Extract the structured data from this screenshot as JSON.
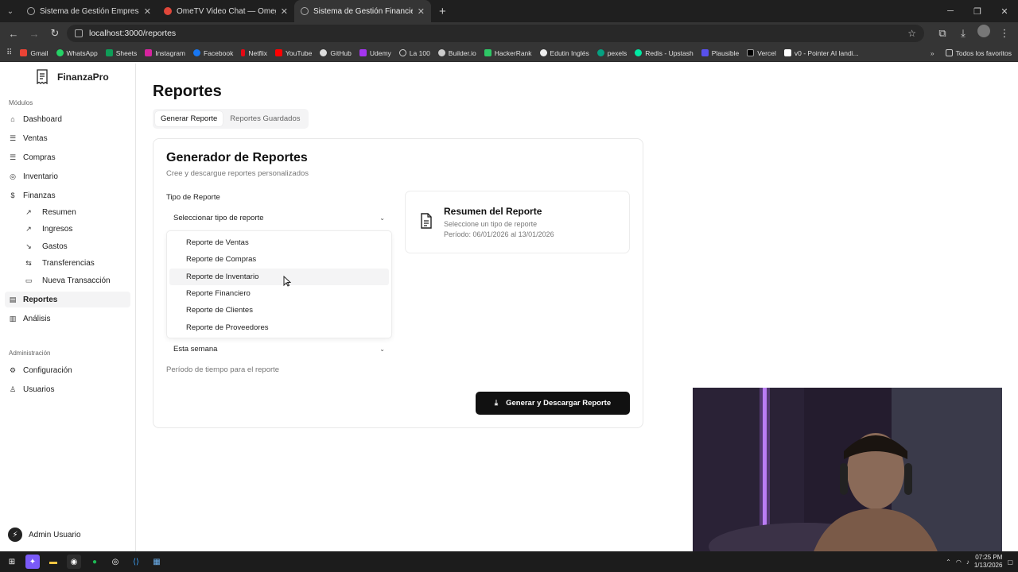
{
  "browser": {
    "tabs": [
      {
        "title": "Sistema de Gestión Empresarial",
        "active": false
      },
      {
        "title": "OmeTV Video Chat — Omegle",
        "active": false
      },
      {
        "title": "Sistema de Gestión Financiera",
        "active": true
      }
    ],
    "url": "localhost:3000/reportes",
    "bookmarks": [
      "Gmail",
      "WhatsApp",
      "Sheets",
      "Instagram",
      "Facebook",
      "Netflix",
      "YouTube",
      "GitHub",
      "Udemy",
      "La 100",
      "Builder.io",
      "HackerRank",
      "Edutin Inglés",
      "pexels",
      "Redis - Upstash",
      "Plausible",
      "Vercel",
      "v0 - Pointer AI landi..."
    ],
    "all_bookmarks": "Todos los favoritos"
  },
  "sidebar": {
    "brand": "FinanzaPro",
    "modules_label": "Módulos",
    "items": [
      {
        "label": "Dashboard",
        "icon": "home-icon"
      },
      {
        "label": "Ventas",
        "icon": "list-icon"
      },
      {
        "label": "Compras",
        "icon": "list-icon"
      },
      {
        "label": "Inventario",
        "icon": "package-icon"
      },
      {
        "label": "Finanzas",
        "icon": "dollar-icon"
      }
    ],
    "sub_items": [
      {
        "label": "Resumen",
        "icon": "trend-icon"
      },
      {
        "label": "Ingresos",
        "icon": "arrow-up-icon"
      },
      {
        "label": "Gastos",
        "icon": "arrow-down-icon"
      },
      {
        "label": "Transferencias",
        "icon": "swap-icon"
      },
      {
        "label": "Nueva Transacción",
        "icon": "card-icon"
      }
    ],
    "items_after": [
      {
        "label": "Reportes",
        "icon": "file-icon",
        "active": true
      },
      {
        "label": "Análisis",
        "icon": "chart-icon"
      }
    ],
    "admin_label": "Administración",
    "admin_items": [
      {
        "label": "Configuración",
        "icon": "gear-icon"
      },
      {
        "label": "Usuarios",
        "icon": "users-icon"
      }
    ],
    "user": "Admin Usuario"
  },
  "main": {
    "title": "Reportes",
    "tabs": [
      "Generar Reporte",
      "Reportes Guardados"
    ],
    "card": {
      "title": "Generador de Reportes",
      "subtitle": "Cree y descargue reportes personalizados",
      "type_label": "Tipo de Reporte",
      "type_placeholder": "Seleccionar tipo de reporte",
      "options": [
        "Reporte de Ventas",
        "Reporte de Compras",
        "Reporte de Inventario",
        "Reporte Financiero",
        "Reporte de Clientes",
        "Reporte de Proveedores"
      ],
      "hovered_option": "Reporte de Inventario",
      "period_value": "Esta semana",
      "period_help": "Período de tiempo para el reporte",
      "summary_title": "Resumen del Reporte",
      "summary_line1": "Seleccione un tipo de reporte",
      "summary_line2": "Período: 06/01/2026 al 13/01/2026",
      "button": "Generar y Descargar Reporte"
    }
  },
  "taskbar": {
    "time": "07:25 PM",
    "date": "1/13/2026"
  }
}
